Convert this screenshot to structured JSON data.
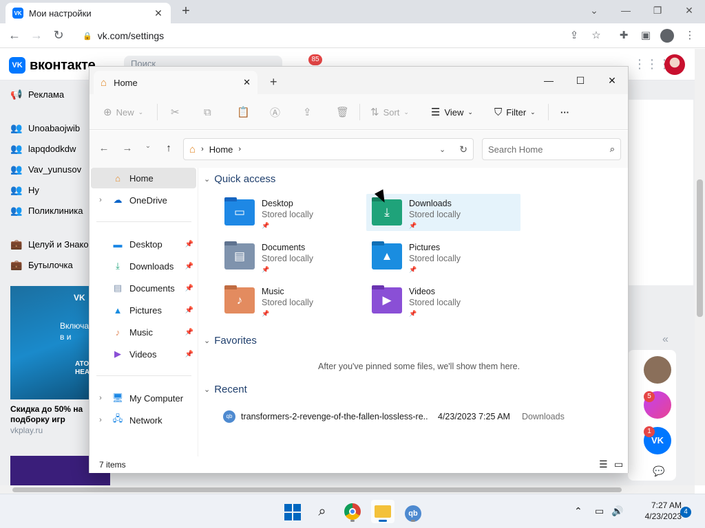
{
  "browser": {
    "tab_title": "Мои настройки",
    "tab_favicon": "VK",
    "url": "vk.com/settings",
    "window_controls": [
      "chevron-down-icon",
      "minimize-icon",
      "restore-icon",
      "close-icon"
    ]
  },
  "vk": {
    "logo_text": "вконтакте",
    "logo_badge": "VK",
    "search_placeholder": "Поиск",
    "notifications_count": "85",
    "left_menu": [
      {
        "label": "Реклама",
        "icon": "megaphone-icon"
      },
      {
        "label": "Unoabaojwib",
        "icon": "users-icon"
      },
      {
        "label": "lapqdodkdw",
        "icon": "users-icon"
      },
      {
        "label": "Vav_yunusov",
        "icon": "users-icon"
      },
      {
        "label": "Ну",
        "icon": "users-icon"
      },
      {
        "label": "Поликлиника",
        "icon": "users-icon"
      },
      {
        "label": "Целуй и Знакомься",
        "icon": "briefcase-icon"
      },
      {
        "label": "Бутылочка",
        "icon": "briefcase-icon"
      }
    ],
    "ad_title": "Скидка до 50% на подборку игр",
    "ad_source": "vkplay.ru",
    "ad_overlay": "VK",
    "ad_text": "Включа\nв и",
    "ad_badge": "ATO\nHEA",
    "right_badges": {
      "music": "5",
      "vk": "1"
    },
    "right_vk_label": "VK"
  },
  "explorer": {
    "tab_title": "Home",
    "toolbar": {
      "new": "New",
      "sort": "Sort",
      "view": "View",
      "filter": "Filter",
      "more": "···"
    },
    "address": {
      "crumb": "Home",
      "search_placeholder": "Search Home"
    },
    "nav": {
      "home": "Home",
      "onedrive": "OneDrive",
      "pinned": [
        {
          "label": "Desktop",
          "icon": "desktop-icon"
        },
        {
          "label": "Downloads",
          "icon": "download-icon"
        },
        {
          "label": "Documents",
          "icon": "document-icon"
        },
        {
          "label": "Pictures",
          "icon": "picture-icon"
        },
        {
          "label": "Music",
          "icon": "music-icon"
        },
        {
          "label": "Videos",
          "icon": "video-icon"
        }
      ],
      "my_computer": "My Computer",
      "network": "Network"
    },
    "quick_access": {
      "title": "Quick access",
      "items": [
        {
          "name": "Desktop",
          "sub": "Stored locally",
          "color": "#1e88e5"
        },
        {
          "name": "Downloads",
          "sub": "Stored locally",
          "color": "#1fa37a"
        },
        {
          "name": "Documents",
          "sub": "Stored locally",
          "color": "#7f93ad"
        },
        {
          "name": "Pictures",
          "sub": "Stored locally",
          "color": "#1a8de0"
        },
        {
          "name": "Music",
          "sub": "Stored locally",
          "color": "#e38b5f"
        },
        {
          "name": "Videos",
          "sub": "Stored locally",
          "color": "#8a4fd6"
        }
      ]
    },
    "favorites": {
      "title": "Favorites",
      "empty_text": "After you've pinned some files, we'll show them here."
    },
    "recent": {
      "title": "Recent",
      "items": [
        {
          "name": "transformers-2-revenge-of-the-fallen-lossless-re...",
          "date": "4/23/2023 7:25 AM",
          "location": "Downloads"
        }
      ]
    },
    "status": {
      "count": "7 items"
    }
  },
  "taskbar": {
    "apps": [
      "start-icon",
      "search-icon",
      "chrome-icon",
      "file-explorer-icon",
      "qbittorrent-icon"
    ],
    "qb_label": "qb",
    "time": "7:27 AM",
    "date": "4/23/2023",
    "notification_count": "4"
  }
}
